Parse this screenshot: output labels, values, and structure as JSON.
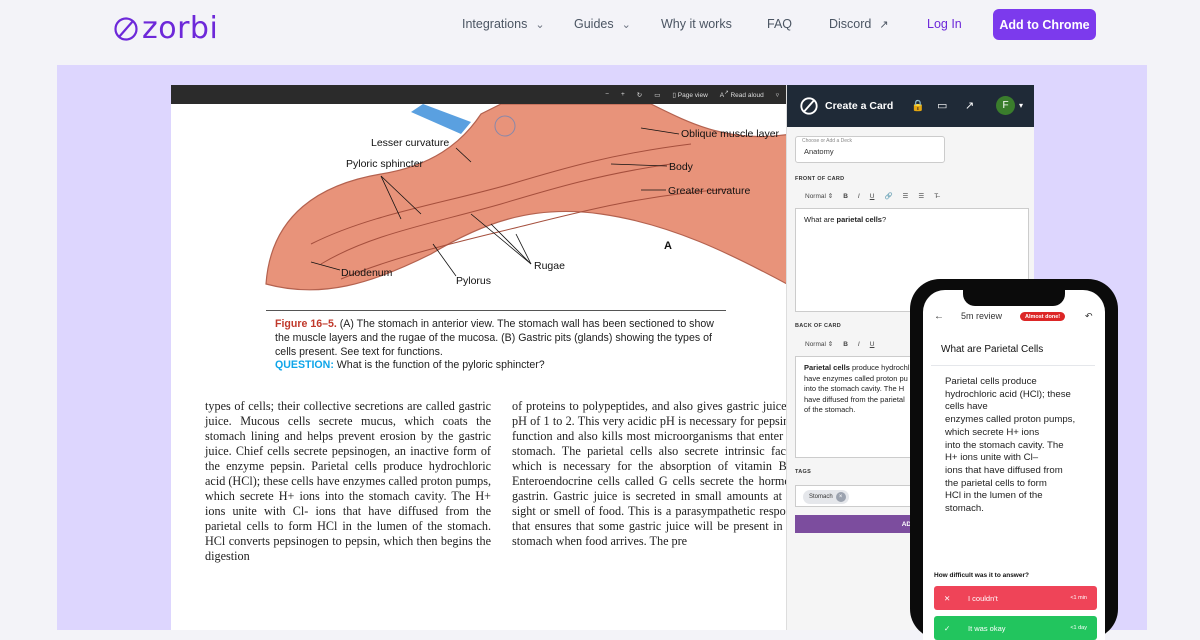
{
  "nav": {
    "logo_text": "zorbi",
    "items": [
      {
        "label": "Integrations",
        "has_dropdown": true
      },
      {
        "label": "Guides",
        "has_dropdown": true
      },
      {
        "label": "Why it works",
        "has_dropdown": false
      },
      {
        "label": "FAQ",
        "has_dropdown": false
      },
      {
        "label": "Discord",
        "has_dropdown": false
      }
    ],
    "login": "Log In",
    "cta": "Add to Chrome",
    "brand_color": "#7c3aed"
  },
  "pdf": {
    "toolbar": {
      "minus": "−",
      "plus": "+",
      "page_view": "Page view",
      "read_aloud": "Read aloud"
    },
    "illustration_labels": {
      "lesser_curvature": "Lesser curvature",
      "pyloric_sphincter": "Pyloric sphincter",
      "oblique_muscle": "Oblique muscle layer",
      "body": "Body",
      "greater_curvature": "Greater curvature",
      "duodenum": "Duodenum",
      "pylorus": "Pylorus",
      "rugae": "Rugae",
      "panel_letter": "A"
    },
    "caption": {
      "figure": "Figure 16–5.",
      "text": " (A) The stomach in anterior view. The stomach wall has been sectioned to show the muscle layers and the rugae of the mucosa. (B) Gastric pits (glands) showing the types of cells present. See text for functions.",
      "question_label": "QUESTION:",
      "question": " What is the function of the pyloric sphincter?"
    },
    "col1": "types of cells; their collective secretions are called gastric juice. Mucous cells secrete mucus, which coats the stomach lining and helps prevent erosion by the gastric juice. Chief cells secrete pepsinogen, an inactive form of the enzyme pepsin. Parietal cells produce hydrochloric acid (HCl); these cells have enzymes called proton pumps, which secrete H+ ions into the stomach cavity. The H+ ions unite with Cl- ions that have diffused from the parietal cells to form HCl in the lumen of the stomach. HCl converts pepsinogen to pepsin, which then begins the digestion",
    "col2": "of proteins to polypeptides, and also gives gastric juice its pH of 1 to 2. This very acidic pH is necessary for pepsin to function and also kills most microorganisms that enter the stomach. The parietal cells also secrete intrinsic factor, which is necessary for the absorption of vitamin B12. Enteroendocrine cells called G cells secrete the hormone gastrin. Gastric juice is secreted in small amounts at the sight or smell of food. This is a parasympathetic response that ensures that some gastric juice will be present in the stomach when food arrives. The pre"
  },
  "card_panel": {
    "title": "Create a Card",
    "avatar": "F",
    "deck_label": "Choose or Add a Deck",
    "deck_value": "Anatomy",
    "front_label": "FRONT OF CARD",
    "back_label": "BACK OF CARD",
    "format_select": "Normal",
    "front_prefix": "What are ",
    "front_bold": "parietal cells",
    "front_suffix": "?",
    "back_bold": "Parietal cells",
    "back_lines": [
      " produce hydrochl",
      "have enzymes called proton pu",
      "into the stomach cavity. The H",
      "have diffused from the parietal",
      "of the stomach."
    ],
    "tags_label": "TAGS",
    "tag": "Stomach",
    "add_button": "ADD C"
  },
  "phone": {
    "review_label": "5m review",
    "badge": "Almost done!",
    "question": "What are Parietal Cells",
    "answer_lines": [
      "Parietal cells produce",
      "hydrochloric acid (HCl); these",
      "cells have",
      "enzymes called proton pumps,",
      "which secrete H+ ions",
      "into the stomach cavity. The",
      "H+ ions unite with Cl–",
      "ions that have diffused from",
      "the parietal cells to form",
      "HCl in the lumen of the",
      "stomach."
    ],
    "difficulty_prompt": "How difficult was it to answer?",
    "buttons": [
      {
        "label": "I couldn't",
        "time": "<1 min",
        "color": "#ef4458"
      },
      {
        "label": "It was okay",
        "time": "<1 day",
        "color": "#22c55e"
      }
    ]
  }
}
